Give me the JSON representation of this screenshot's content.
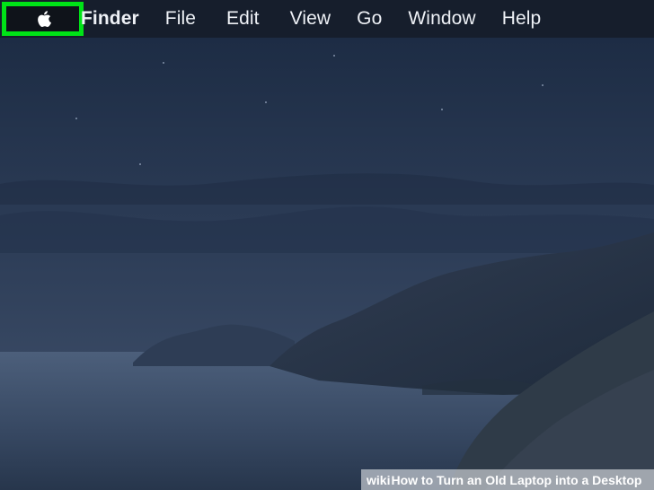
{
  "menubar": {
    "apple_menu": "apple-icon",
    "items": [
      {
        "label": "Finder"
      },
      {
        "label": "File"
      },
      {
        "label": "Edit"
      },
      {
        "label": "View"
      },
      {
        "label": "Go"
      },
      {
        "label": "Window"
      },
      {
        "label": "Help"
      }
    ]
  },
  "watermark": {
    "brand": "wiki",
    "title": "How to Turn an Old Laptop into a Desktop"
  },
  "colors": {
    "highlight": "#00e317",
    "menubar_bg": "#161e2c",
    "sky": "#33435d",
    "sea": "#3a4c66",
    "land": "#26344a"
  }
}
